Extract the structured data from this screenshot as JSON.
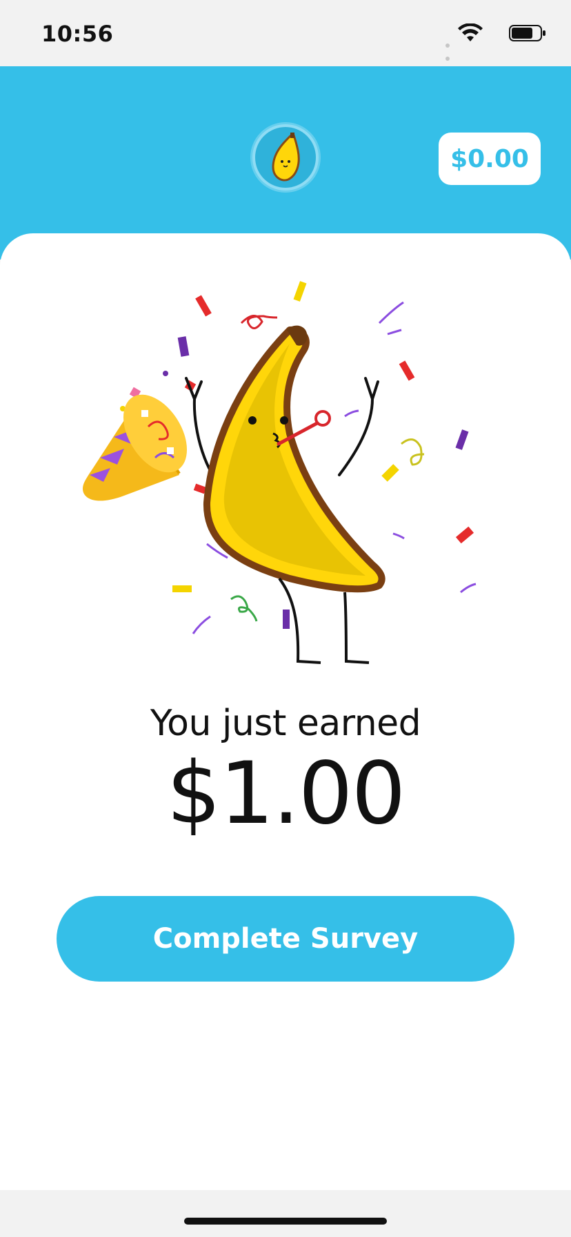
{
  "status_bar": {
    "time": "10:56",
    "icons": [
      "signal-icon",
      "wifi-icon",
      "battery-icon"
    ]
  },
  "header": {
    "avatar_icon": "banana-avatar-icon",
    "balance": "$0.00",
    "background_color": "#35bfe8"
  },
  "reward": {
    "illustration_icon": "celebrating-banana-icon",
    "label": "You just earned",
    "amount": "$1.00"
  },
  "cta": {
    "label": "Complete Survey"
  },
  "colors": {
    "accent": "#35bfe8",
    "text": "#111111",
    "card": "#ffffff"
  }
}
